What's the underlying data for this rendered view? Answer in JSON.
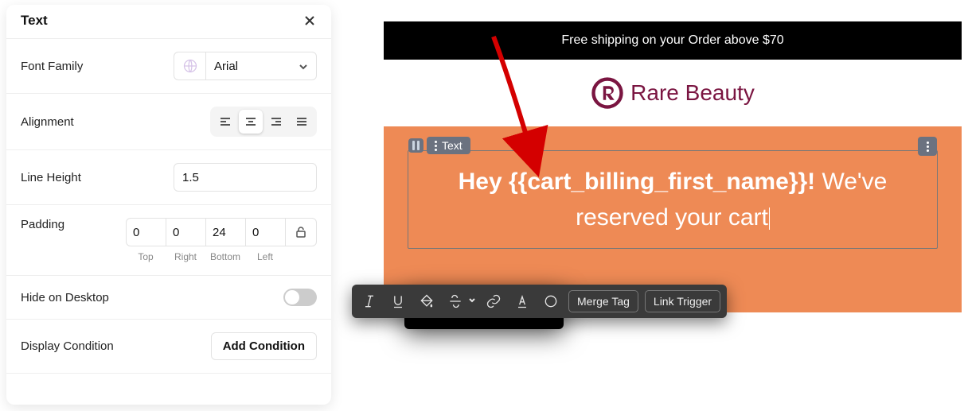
{
  "panel": {
    "title": "Text",
    "font_family": {
      "label": "Font Family",
      "value": "Arial"
    },
    "alignment": {
      "label": "Alignment",
      "options": [
        "left",
        "center",
        "right",
        "justify"
      ],
      "selected": "center"
    },
    "line_height": {
      "label": "Line Height",
      "value": "1.5"
    },
    "padding": {
      "label": "Padding",
      "top": {
        "value": "0",
        "label": "Top"
      },
      "right": {
        "value": "0",
        "label": "Right"
      },
      "bottom": {
        "value": "24",
        "label": "Bottom"
      },
      "left": {
        "value": "0",
        "label": "Left"
      }
    },
    "hide_desktop": {
      "label": "Hide on Desktop",
      "value": false
    },
    "display_condition": {
      "label": "Display Condition",
      "button": "Add Condition"
    }
  },
  "preview": {
    "banner": "Free shipping on your Order above $70",
    "brand": "Rare Beauty",
    "block_tag": "Text",
    "headline_bold": "Hey {{cart_billing_first_name}}!",
    "headline_rest": " We've reserved your cart"
  },
  "toolbar": {
    "merge_tag": "Merge Tag",
    "link_trigger": "Link Trigger"
  }
}
